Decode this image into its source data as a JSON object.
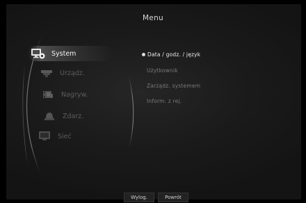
{
  "header": {
    "title": "Menu"
  },
  "sidebar": {
    "items": [
      {
        "label": "System",
        "icon": "monitor-gear-icon",
        "active": true
      },
      {
        "label": "Urządz.",
        "icon": "camera-icon",
        "active": false
      },
      {
        "label": "Nagryw.",
        "icon": "film-icon",
        "active": false
      },
      {
        "label": "Zdarz.",
        "icon": "alarm-icon",
        "active": false
      },
      {
        "label": "Sieć",
        "icon": "monitor-icon",
        "active": false
      }
    ]
  },
  "submenu": {
    "items": [
      {
        "label": "Data / godz. / język",
        "active": true
      },
      {
        "label": "Użytkownik",
        "active": false
      },
      {
        "label": "Zarządz. systemem",
        "active": false
      },
      {
        "label": "Inform. z rej.",
        "active": false
      }
    ]
  },
  "footer": {
    "logout_label": "Wylog.",
    "back_label": "Powrót"
  },
  "colors": {
    "background": "#000000",
    "panel": "#1c1c1c",
    "active_text": "#f2f2f2",
    "inactive_text": "#5c5c5c"
  }
}
